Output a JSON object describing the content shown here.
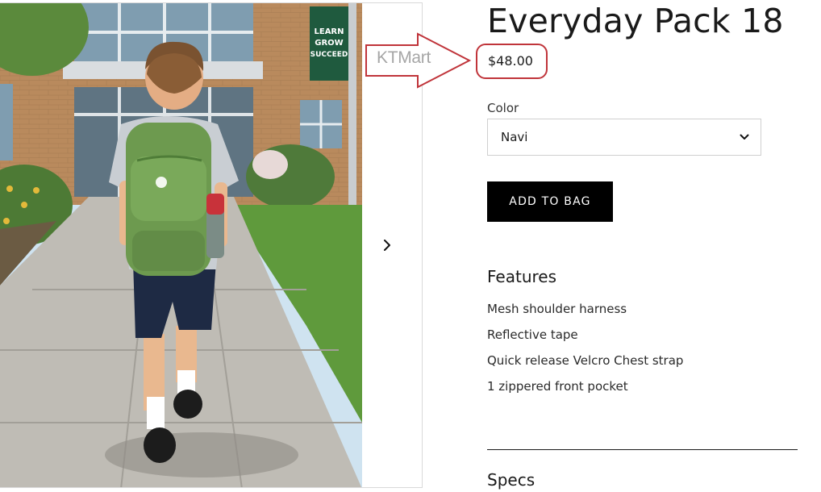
{
  "product": {
    "title": "Everyday Pack 18",
    "price": "$48.00"
  },
  "annotation": {
    "watermark": "KTMart",
    "color": "#c0343a"
  },
  "photo": {
    "banner_text": "LEARN GROW SUCCEED",
    "backpack_color": "#6d9a4f",
    "banner_color": "#1f5a3e"
  },
  "gallery": {
    "next_icon": "chevron-right-icon"
  },
  "color_selector": {
    "label": "Color",
    "selected": "Navi",
    "icon": "chevron-down-icon"
  },
  "actions": {
    "add_to_bag": "ADD TO BAG"
  },
  "features": {
    "heading": "Features",
    "items": [
      "Mesh shoulder harness",
      "Reflective tape",
      "Quick release Velcro Chest strap",
      "1 zippered front pocket"
    ]
  },
  "specs": {
    "heading": "Specs"
  }
}
